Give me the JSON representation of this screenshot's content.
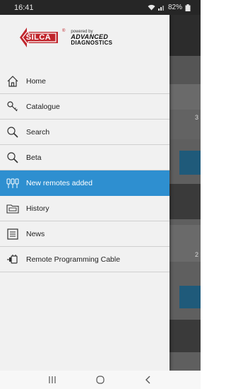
{
  "status_bar": {
    "time": "16:41",
    "battery": "82%",
    "icons": [
      "wifi-icon",
      "signal-icon",
      "battery-icon"
    ]
  },
  "logo": {
    "brand": "SILCA",
    "registered": "®",
    "partner_top": "powered by",
    "partner_mid": "ADVANCED",
    "partner_bot": "DIAGNOSTICS"
  },
  "menu": {
    "items": [
      {
        "label": "Home",
        "icon": "home-icon",
        "active": false
      },
      {
        "label": "Catalogue",
        "icon": "key-icon",
        "active": false
      },
      {
        "label": "Search",
        "icon": "search-icon",
        "active": false
      },
      {
        "label": "Beta",
        "icon": "search-icon",
        "active": false
      },
      {
        "label": "New remotes added",
        "icon": "remotes-icon",
        "active": true
      },
      {
        "label": "History",
        "icon": "history-icon",
        "active": false
      },
      {
        "label": "News",
        "icon": "news-icon",
        "active": false
      },
      {
        "label": "Remote Programming Cable",
        "icon": "cable-icon",
        "active": false
      }
    ]
  },
  "background": {
    "peek_text_1": "3",
    "peek_text_2": "2"
  },
  "nav_bar": {
    "buttons": [
      "recents-icon",
      "home-circle-icon",
      "back-icon"
    ]
  },
  "colors": {
    "accent": "#2e8fd0",
    "drawer_bg": "#f1f1f1",
    "brand_red": "#c0262d"
  }
}
